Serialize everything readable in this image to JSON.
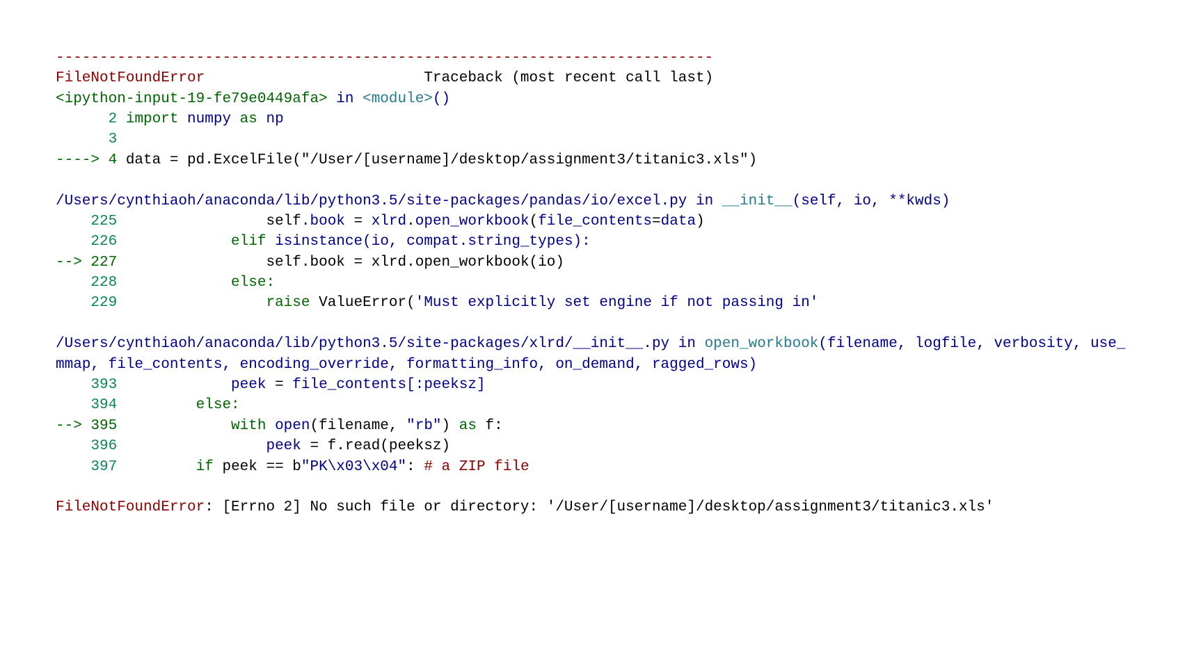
{
  "divider": "---------------------------------------------------------------------------",
  "errorName": "FileNotFoundError",
  "tracebackLabel": "Traceback (most recent call last)",
  "space_error_trace": "                         ",
  "input_ref": "<ipython-input-19-fe79e0449afa>",
  "in_word": " in ",
  "module_ref": "<module>",
  "module_call": "()",
  "line2a": "      2",
  "line2_import": " import",
  "line2_numpy": " numpy",
  "line2_as": " as",
  "line2_np": " np",
  "line3a": "      3",
  "line4_arrow": "----> 4",
  "line4_code": " data = pd.ExcelFile(\"/User/[username]/desktop/assignment3/titanic3.xls\")",
  "path1": "/Users/cynthiaoh/anaconda/lib/python3.5/site-packages/pandas/io/excel.py",
  "init_ref": "__init__",
  "init_args": "(self, io, **kwds)",
  "l225_num": "    225",
  "l225_ws": "                 self",
  "l225_dot": ".",
  "l225_book": "book",
  "l225_eq": " = ",
  "l225_xlrd": "xlrd",
  "l225_ow": "open_workbook",
  "l225_lp": "(",
  "l225_fc": "file_contents",
  "l225_eqd": "=",
  "l225_data": "data",
  "l225_rp": ")",
  "l226_num": "    226",
  "l226_elif": "             elif",
  "l226_isin": " isinstance",
  "l226_args": "(io, compat.string_types):",
  "l227_arrow": "--> 227",
  "l227_self": "                 self",
  "l227_dot": ".",
  "l227_book": "book",
  "l227_eq": " = xlrd.open_workbook(io)",
  "l228_num": "    228",
  "l228_else": "             else:",
  "l229_num": "    229",
  "l229_raise": "                 raise",
  "l229_ve": " ValueError(",
  "l229_str": "'Must explicitly set engine if not passing in'",
  "path2": "/Users/cynthiaoh/anaconda/lib/python3.5/site-packages/xlrd/__init__.py",
  "ow_ref": "open_workbook",
  "ow_args": "(filename, logfile, verbosity, use_mmap, file_contents, encoding_override, formatting_info, on_demand, ragged_rows)",
  "l393_num": "    393",
  "l393_peek": "             peek",
  "l393_eq": " = ",
  "l393_fc": "file_contents",
  "l393_slice": "[:peeksz]",
  "l394_num": "    394",
  "l394_else": "         else:",
  "l395_arrow": "--> 395",
  "l395_with": "             with",
  "l395_open": " open",
  "l395_args": "(filename, ",
  "l395_rb": "\"rb\"",
  "l395_close": ")",
  "l395_as": " as",
  "l395_f": " f:",
  "l396_num": "    396",
  "l396_peek": "                 peek",
  "l396_rest": " = f.read(peeksz)",
  "l397_num": "    397",
  "l397_if": "         if",
  "l397_peek": " peek == b",
  "l397_pk": "\"PK\\x03\\x04\"",
  "l397_colon": ":",
  "l397_comment": " # a ZIP file",
  "final_error": "FileNotFoundError",
  "final_msg": ": [Errno 2] No such file or directory: '/User/[username]/desktop/assignment3/titanic3.xls'"
}
